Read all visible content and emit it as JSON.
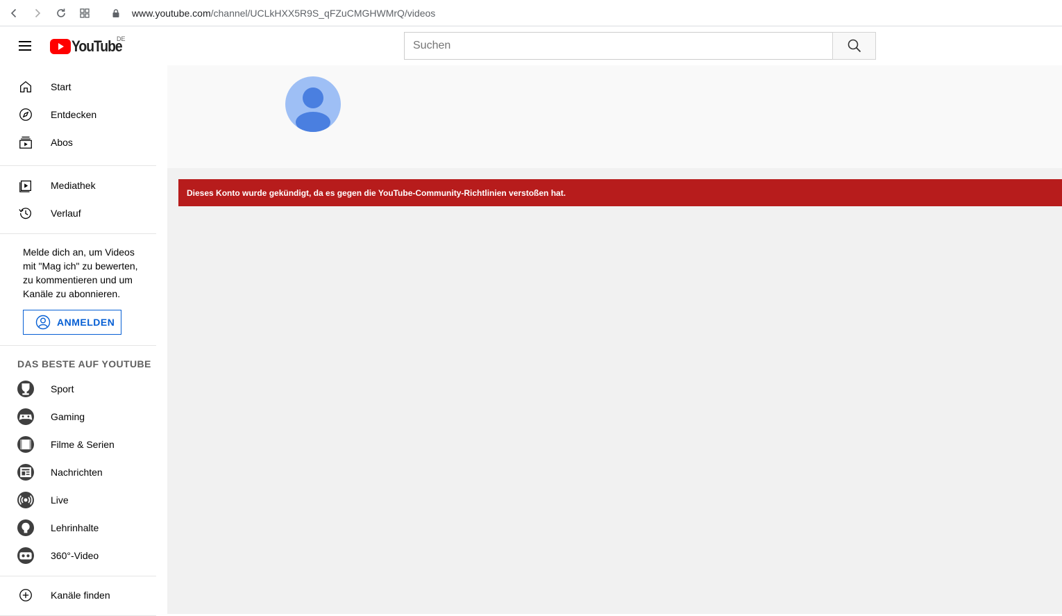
{
  "browser": {
    "url_host": "www.youtube.com",
    "url_path": "/channel/UCLkHXX5R9S_qFZuCMGHWMrQ/videos"
  },
  "masthead": {
    "logo_text": "YouTube",
    "country_code": "DE",
    "search_placeholder": "Suchen"
  },
  "sidebar": {
    "primary": [
      {
        "label": "Start",
        "icon": "home-icon"
      },
      {
        "label": "Entdecken",
        "icon": "compass-icon"
      },
      {
        "label": "Abos",
        "icon": "subscriptions-icon"
      }
    ],
    "library": [
      {
        "label": "Mediathek",
        "icon": "library-icon"
      },
      {
        "label": "Verlauf",
        "icon": "history-icon"
      }
    ],
    "signin": {
      "text": "Melde dich an, um Videos mit \"Mag ich\" zu bewerten, zu kommentieren und um Kanäle zu abonnieren.",
      "button_label": "ANMELDEN"
    },
    "best_title": "DAS BESTE AUF YOUTUBE",
    "best": [
      {
        "label": "Sport",
        "icon": "trophy-icon"
      },
      {
        "label": "Gaming",
        "icon": "gamepad-icon"
      },
      {
        "label": "Filme & Serien",
        "icon": "film-icon"
      },
      {
        "label": "Nachrichten",
        "icon": "newspaper-icon"
      },
      {
        "label": "Live",
        "icon": "live-icon"
      },
      {
        "label": "Lehrinhalte",
        "icon": "lightbulb-icon"
      },
      {
        "label": "360°-Video",
        "icon": "vr-icon"
      }
    ],
    "more": [
      {
        "label": "Kanäle finden",
        "icon": "add-circle-icon"
      }
    ]
  },
  "main": {
    "alert_text": "Dieses Konto wurde gekündigt, da es gegen die YouTube-Community-Richtlinien verstoßen hat."
  },
  "colors": {
    "brand_red": "#ff0000",
    "alert_red": "#b71c1c",
    "link_blue": "#065fd4",
    "avatar_bg": "#9ebff5",
    "avatar_fg": "#4a7fe0"
  }
}
